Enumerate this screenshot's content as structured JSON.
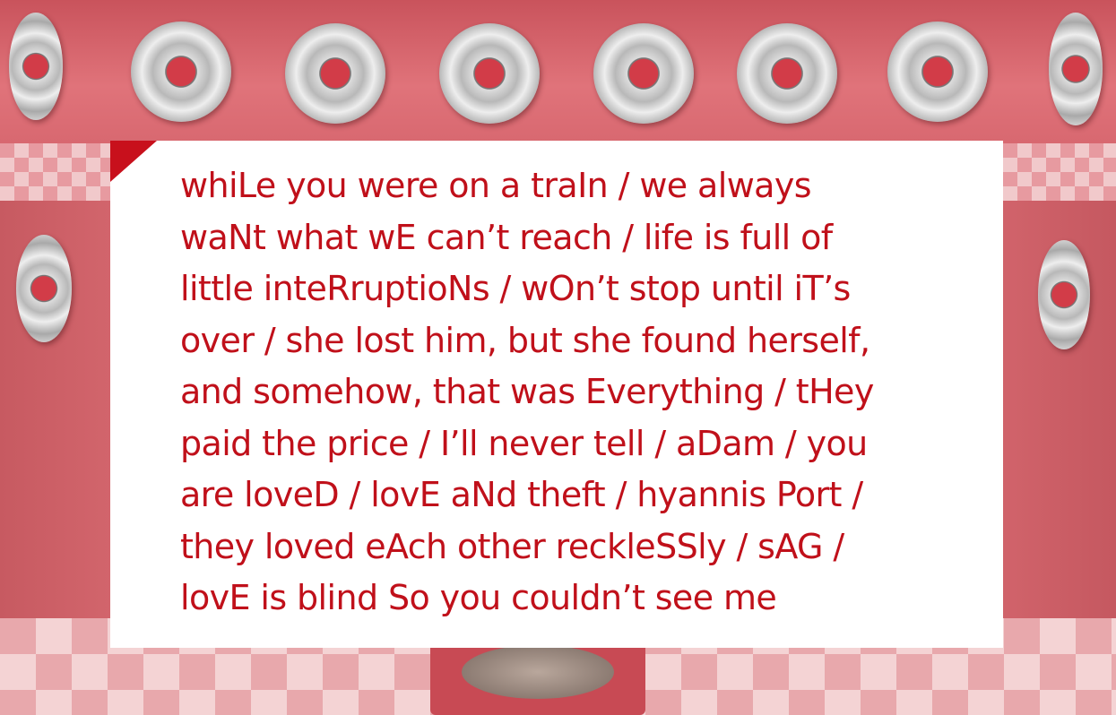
{
  "poem": {
    "text": "whiLe you were on a traIn / we always\nwaNt what wE can’t reach / life is full of\nlittle inteRruptioNs / wOn’t stop until iT’s\nover / she lost him, but she found herself,\nand somehow, that was Everything / tHey\npaid the price / I’ll never tell / aDam / you\nare loveD / lovE aNd theft / hyannis Port /\nthey loved eAch other reckleSSly / sAG /\nlovE is blind So you couldn’t see me"
  },
  "colors": {
    "text": "#c0101a",
    "corner_accent": "#c8101c",
    "card": "#ffffff",
    "wall": "#d9676e"
  }
}
